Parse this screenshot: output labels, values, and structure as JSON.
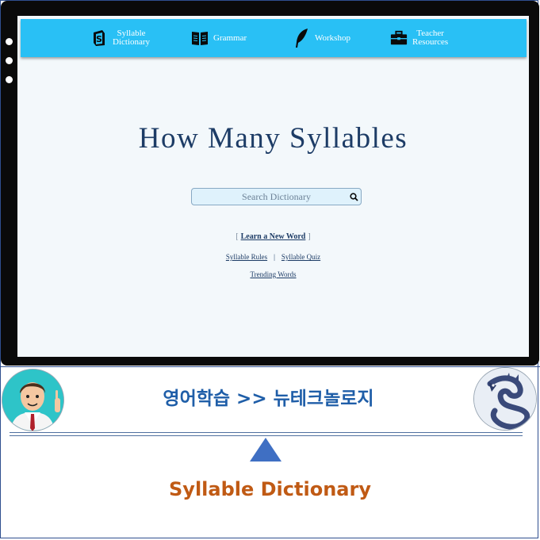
{
  "nav": {
    "items": [
      {
        "id": "syllable-dictionary",
        "line1": "Syllable",
        "line2": "Dictionary",
        "icon": "s-logo-icon"
      },
      {
        "id": "grammar",
        "line1": "Grammar",
        "line2": "",
        "icon": "book-icon"
      },
      {
        "id": "workshop",
        "line1": "Workshop",
        "line2": "",
        "icon": "quill-icon"
      },
      {
        "id": "teacher-resources",
        "line1": "Teacher",
        "line2": "Resources",
        "icon": "briefcase-icon"
      }
    ]
  },
  "main": {
    "title": "How Many Syllables",
    "search_placeholder": "Search Dictionary",
    "learn_new_word": "Learn a New Word",
    "syllable_rules": "Syllable Rules",
    "syllable_quiz": "Syllable Quiz",
    "trending_words": "Trending Words"
  },
  "banner": {
    "heading": "영어학습 >> 뉴테크놀로지",
    "subtitle": "Syllable Dictionary"
  },
  "colors": {
    "navbar": "#29c0f5",
    "title": "#1d3c66",
    "banner_heading": "#1f5ea8",
    "subtitle": "#c05a14",
    "triangle": "#3f6fc3"
  }
}
